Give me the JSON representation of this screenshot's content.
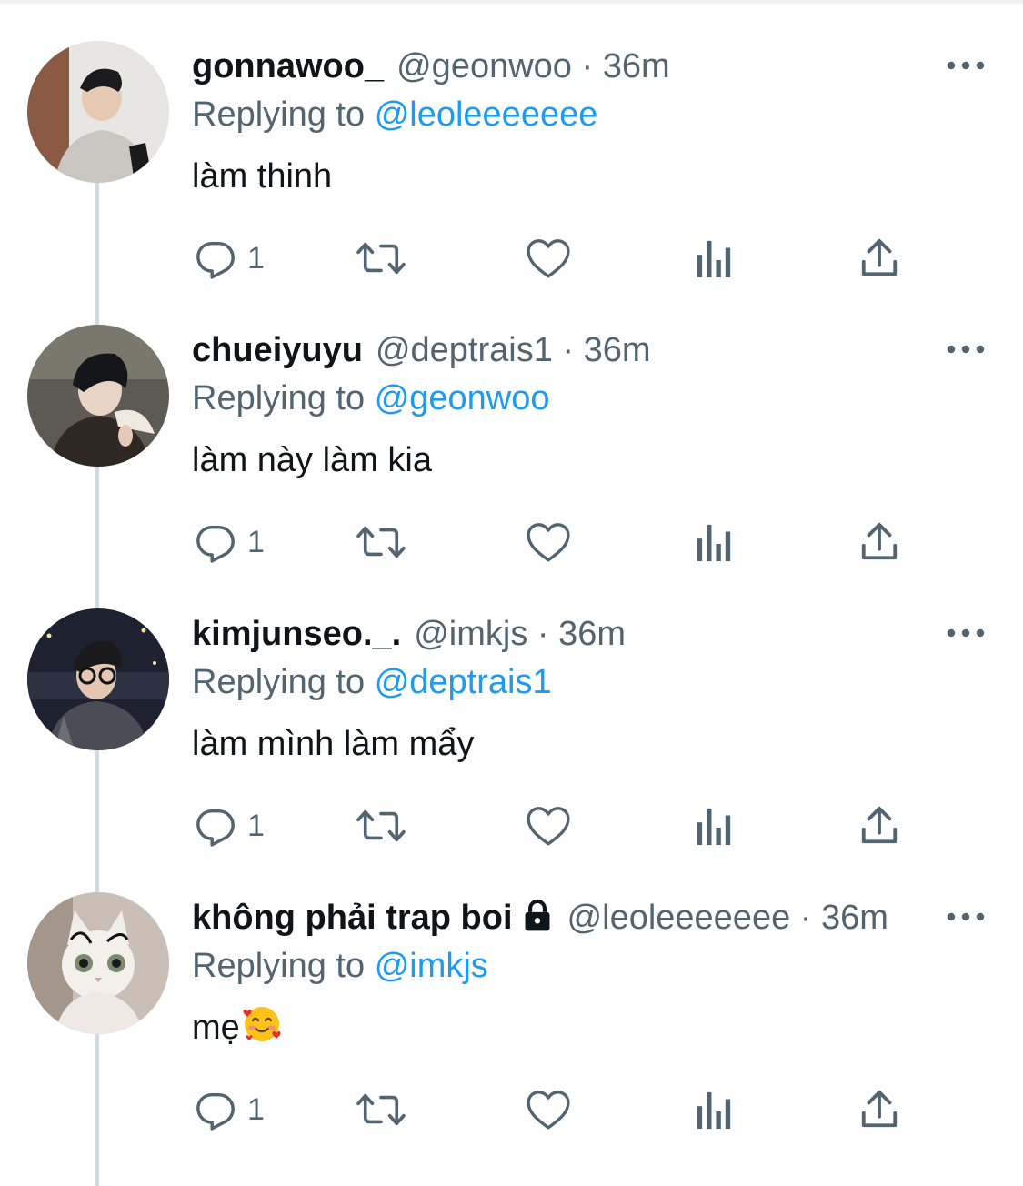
{
  "tweets": [
    {
      "display_name": "gonnawoo_",
      "handle": "@geonwoo",
      "separator": "·",
      "time": "36m",
      "replying_prefix": "Replying to",
      "replying_to": "@leoleeeeeee",
      "text": "làm thinh",
      "reply_count": "1",
      "locked": false
    },
    {
      "display_name": "chueiyuyu",
      "handle": "@deptrais1",
      "separator": "·",
      "time": "36m",
      "replying_prefix": "Replying to",
      "replying_to": "@geonwoo",
      "text": "làm này làm kia",
      "reply_count": "1",
      "locked": false
    },
    {
      "display_name": "kimjunseo._.",
      "handle": "@imkjs",
      "separator": "·",
      "time": "36m",
      "replying_prefix": "Replying to",
      "replying_to": "@deptrais1",
      "text": "làm mình làm mẩy",
      "reply_count": "1",
      "locked": false
    },
    {
      "display_name": "không phải trap boi",
      "handle": "@leoleeeeeee",
      "separator": "·",
      "time": "36m",
      "replying_prefix": "Replying to",
      "replying_to": "@imkjs",
      "text": "mẹ",
      "reply_count": "1",
      "locked": true,
      "emoji": "smiling-face-with-hearts"
    }
  ],
  "icons": {
    "reply": "reply-icon",
    "retweet": "retweet-icon",
    "like": "like-icon",
    "views": "views-icon",
    "share": "share-icon",
    "more": "more-icon",
    "lock": "lock-icon"
  },
  "colors": {
    "text_primary": "#0f1419",
    "text_secondary": "#536471",
    "link": "#1d9bf0",
    "thread_line": "#cfd9de"
  }
}
